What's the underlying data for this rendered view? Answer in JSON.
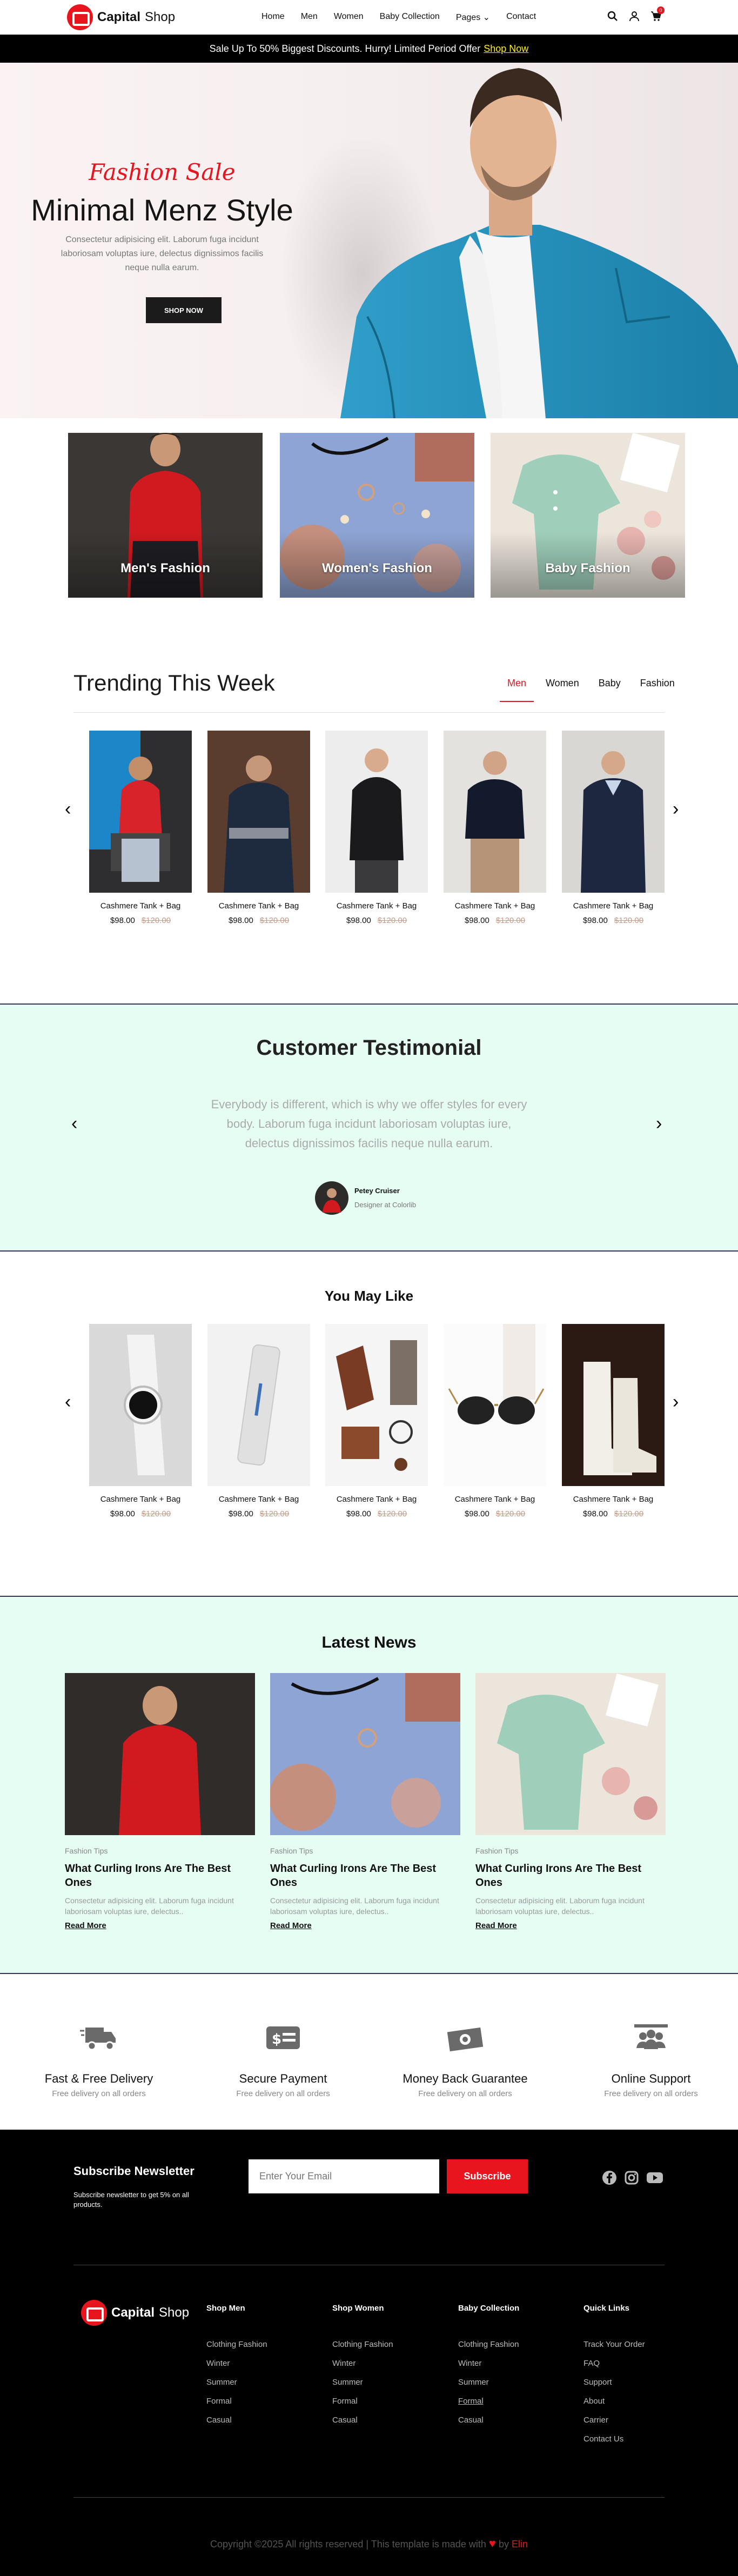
{
  "header": {
    "brand_bold": "Capital",
    "brand_light": "Shop",
    "nav": [
      "Home",
      "Men",
      "Women",
      "Baby Collection",
      "Pages",
      "Contact"
    ],
    "cart_count": "0"
  },
  "banner": {
    "text": "Sale Up To 50% Biggest Discounts. Hurry! Limited Period Offer",
    "link": "Shop Now"
  },
  "hero": {
    "tagline": "Fashion Sale",
    "title": "Minimal Menz Style",
    "text": "Consectetur adipisicing elit. Laborum fuga incidunt laboriosam voluptas iure, delectus dignissimos facilis neque nulla earum.",
    "button": "SHOP NOW"
  },
  "categories": [
    "Men's Fashion",
    "Women's Fashion",
    "Baby Fashion"
  ],
  "trending": {
    "title": "Trending This Week",
    "tabs": [
      "Men",
      "Women",
      "Baby",
      "Fashion"
    ],
    "products": [
      {
        "name": "Cashmere Tank + Bag",
        "price": "$98.00",
        "old": "$120.00"
      },
      {
        "name": "Cashmere Tank + Bag",
        "price": "$98.00",
        "old": "$120.00"
      },
      {
        "name": "Cashmere Tank + Bag",
        "price": "$98.00",
        "old": "$120.00"
      },
      {
        "name": "Cashmere Tank + Bag",
        "price": "$98.00",
        "old": "$120.00"
      },
      {
        "name": "Cashmere Tank + Bag",
        "price": "$98.00",
        "old": "$120.00"
      }
    ]
  },
  "testimonial": {
    "title": "Customer Testimonial",
    "quote": "Everybody is different, which is why we offer styles for every body. Laborum fuga incidunt laboriosam voluptas iure, delectus dignissimos facilis neque nulla earum.",
    "name": "Petey Cruiser",
    "role": "Designer at Colorlib"
  },
  "youmaylike": {
    "title": "You May Like",
    "products": [
      {
        "name": "Cashmere Tank + Bag",
        "price": "$98.00",
        "old": "$120.00"
      },
      {
        "name": "Cashmere Tank + Bag",
        "price": "$98.00",
        "old": "$120.00"
      },
      {
        "name": "Cashmere Tank + Bag",
        "price": "$98.00",
        "old": "$120.00"
      },
      {
        "name": "Cashmere Tank + Bag",
        "price": "$98.00",
        "old": "$120.00"
      },
      {
        "name": "Cashmere Tank + Bag",
        "price": "$98.00",
        "old": "$120.00"
      }
    ]
  },
  "news": {
    "title": "Latest News",
    "items": [
      {
        "cat": "Fashion Tips",
        "title": "What Curling Irons Are The Best Ones",
        "text": "Consectetur adipisicing elit. Laborum fuga incidunt laboriosam voluptas iure, delectus..",
        "link": "Read More"
      },
      {
        "cat": "Fashion Tips",
        "title": "What Curling Irons Are The Best Ones",
        "text": "Consectetur adipisicing elit. Laborum fuga incidunt laboriosam voluptas iure, delectus..",
        "link": "Read More"
      },
      {
        "cat": "Fashion Tips",
        "title": "What Curling Irons Are The Best Ones",
        "text": "Consectetur adipisicing elit. Laborum fuga incidunt laboriosam voluptas iure, delectus..",
        "link": "Read More"
      }
    ]
  },
  "features": [
    {
      "title": "Fast & Free Delivery",
      "sub": "Free delivery on all orders",
      "icon": "truck-icon"
    },
    {
      "title": "Secure Payment",
      "sub": "Free delivery on all orders",
      "icon": "payment-icon"
    },
    {
      "title": "Money Back Guarantee",
      "sub": "Free delivery on all orders",
      "icon": "money-icon"
    },
    {
      "title": "Online Support",
      "sub": "Free delivery on all orders",
      "icon": "support-icon"
    }
  ],
  "footer": {
    "newsletter_title": "Subscribe Newsletter",
    "newsletter_text": "Subscribe newsletter to get 5% on all products.",
    "email_placeholder": "Enter Your Email",
    "subscribe": "Subscribe",
    "cols": [
      {
        "title": "Shop Men",
        "links": [
          "Clothing Fashion",
          "Winter",
          "Summer",
          "Formal",
          "Casual"
        ]
      },
      {
        "title": "Shop Women",
        "links": [
          "Clothing Fashion",
          "Winter",
          "Summer",
          "Formal",
          "Casual"
        ]
      },
      {
        "title": "Baby Collection",
        "links": [
          "Clothing Fashion",
          "Winter",
          "Summer",
          "Formal",
          "Casual"
        ]
      },
      {
        "title": "Quick Links",
        "links": [
          "Track Your Order",
          "FAQ",
          "Support",
          "About",
          "Carrier",
          "Contact Us"
        ]
      }
    ],
    "copyright": "Copyright ©2025 All rights reserved | This template is made with",
    "by": "by",
    "author": "Elin"
  },
  "colors": {
    "accent": "#e8151f",
    "mint": "#e6fdf4",
    "dark": "#000000"
  }
}
